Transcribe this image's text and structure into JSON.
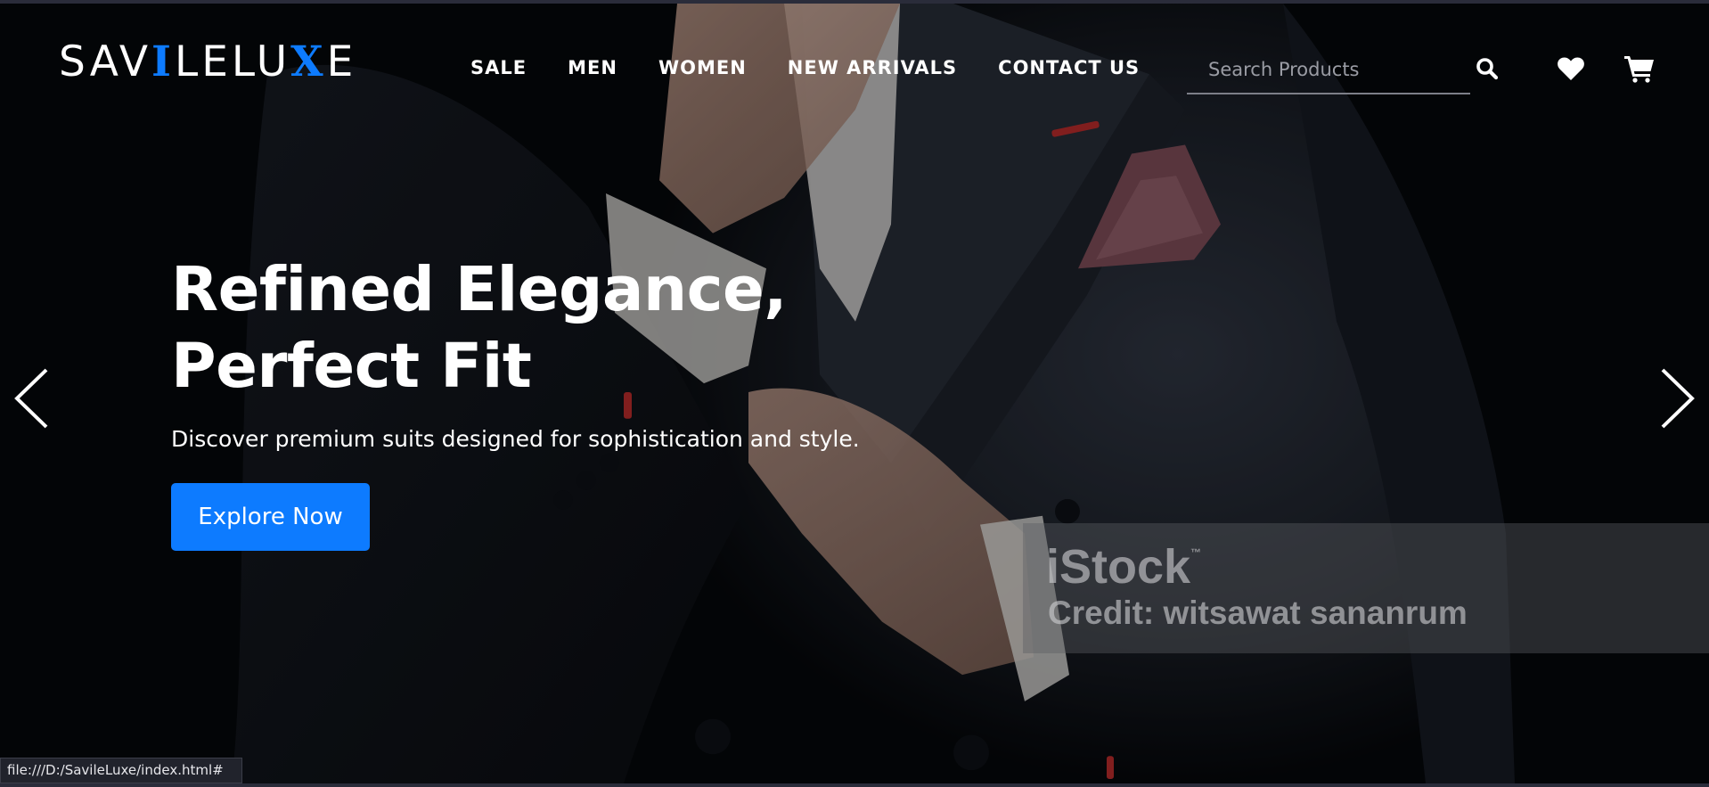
{
  "brand": {
    "parts": [
      "SAV",
      "I",
      "LELU",
      "X",
      "E"
    ],
    "accent_color": "#0d7bff"
  },
  "nav": {
    "items": [
      "SALE",
      "MEN",
      "WOMEN",
      "NEW ARRIVALS",
      "CONTACT US"
    ]
  },
  "search": {
    "placeholder": "Search Products",
    "value": ""
  },
  "icons": {
    "search": "search-icon",
    "wishlist": "heart-icon",
    "cart": "cart-icon",
    "prev": "chevron-left-icon",
    "next": "chevron-right-icon"
  },
  "hero": {
    "title_line1": "Refined Elegance,",
    "title_line2": "Perfect Fit",
    "subtitle": "Discover premium suits designed for sophistication and style.",
    "cta_label": "Explore Now",
    "cta_color": "#0d7bff"
  },
  "watermark": {
    "brand": "iStock",
    "trademark": "™",
    "credit": "Credit: witsawat sananrum"
  },
  "status_bar": {
    "url": "file:///D:/SavileLuxe/index.html#"
  }
}
